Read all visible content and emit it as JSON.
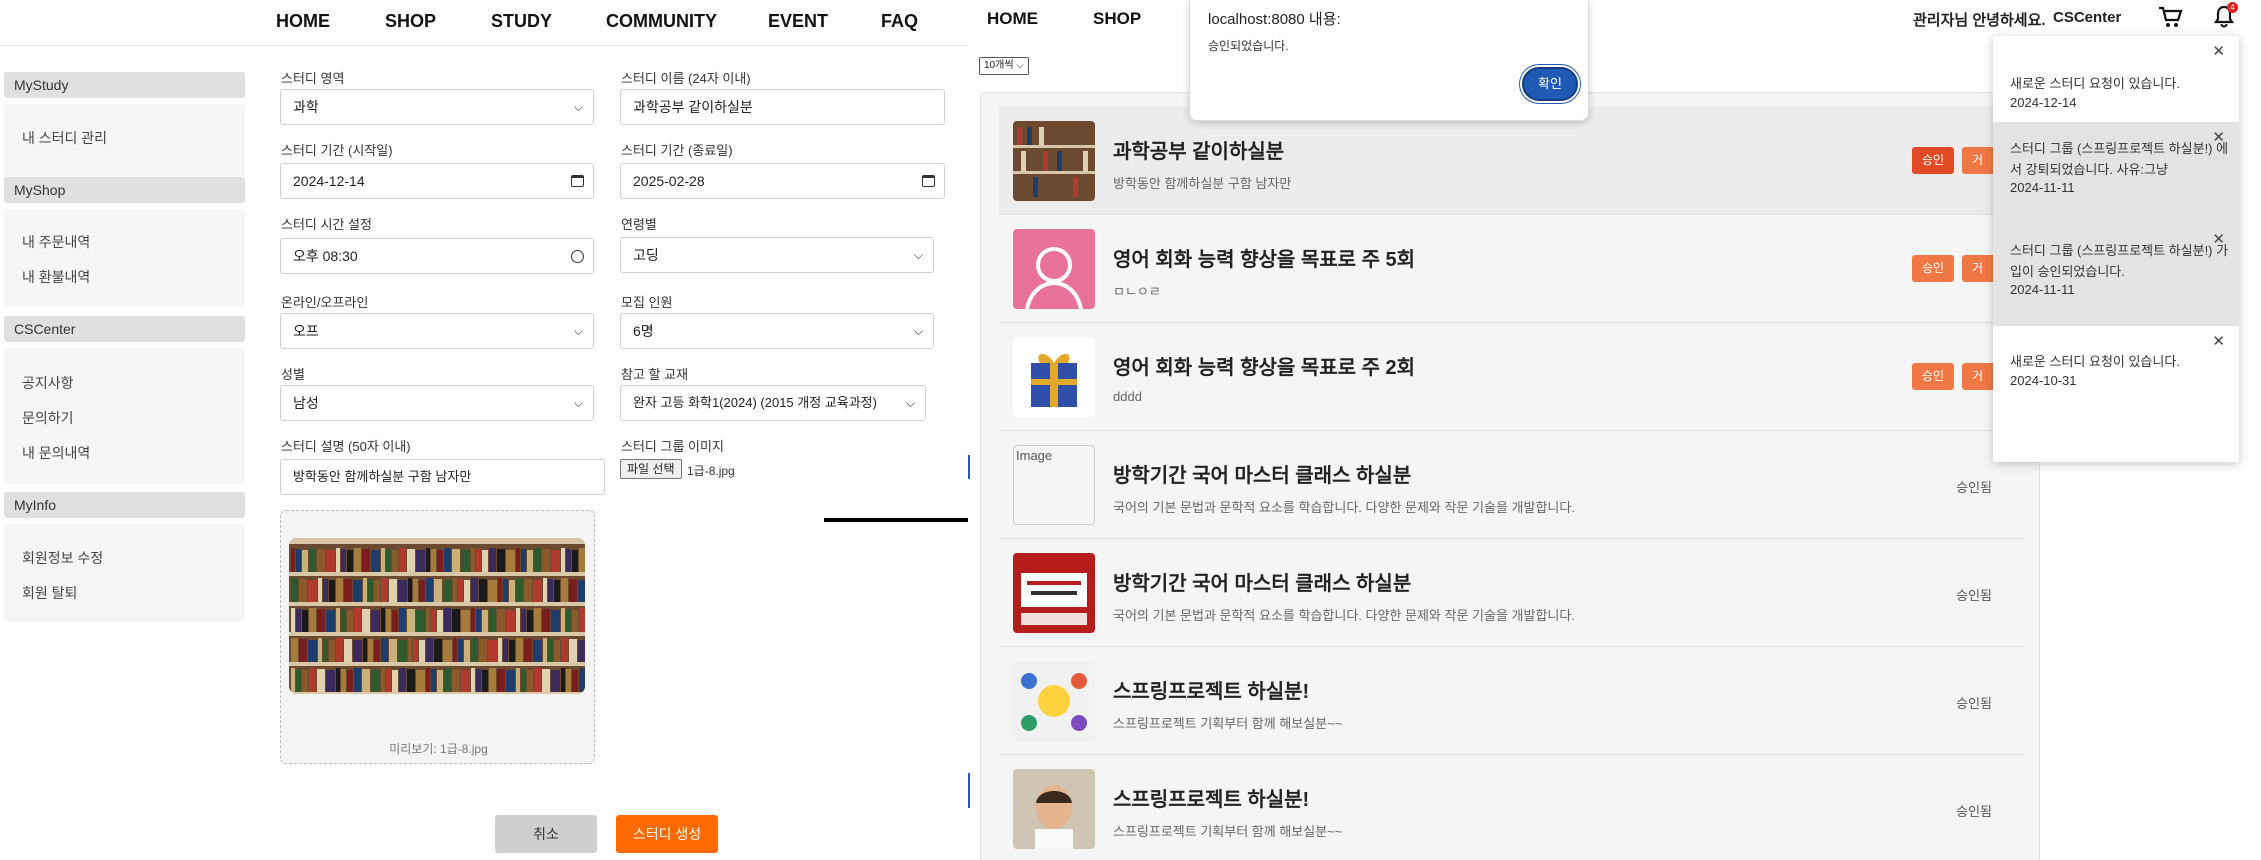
{
  "left_nav": [
    "HOME",
    "SHOP",
    "STUDY",
    "COMMUNITY",
    "EVENT",
    "FAQ"
  ],
  "sidebar": {
    "sections": [
      {
        "title": "MyStudy",
        "items": [
          "내 스터디 관리"
        ]
      },
      {
        "title": "MyShop",
        "items": [
          "내 주문내역",
          "내 환불내역"
        ]
      },
      {
        "title": "CSCenter",
        "items": [
          "공지사항",
          "문의하기",
          "내 문의내역"
        ]
      },
      {
        "title": "MyInfo",
        "items": [
          "회원정보 수정",
          "회원 탈퇴"
        ]
      }
    ]
  },
  "form": {
    "area_label": "스터디 영역",
    "area_value": "과학",
    "name_label": "스터디 이름 (24자 이내)",
    "name_value": "과학공부 같이하실분",
    "start_label": "스터디 기간 (시작일)",
    "start_value": "2024-12-14",
    "end_label": "스터디 기간 (종료일)",
    "end_value": "2025-02-28",
    "time_label": "스터디 시간 설정",
    "time_value": "오후  08:30",
    "age_label": "연령별",
    "age_value": "고딩",
    "mode_label": "온라인/오프라인",
    "mode_value": "오프",
    "capacity_label": "모집 인원",
    "capacity_value": "6명",
    "gender_label": "성별",
    "gender_value": "남성",
    "textbook_label": "참고 할 교재",
    "textbook_value": "완자 고등 화학1(2024) (2015 개정 교육과정)",
    "desc_label": "스터디 설명 (50자 이내)",
    "desc_value": "방학동안 함께하실분 구함 남자만",
    "image_label": "스터디 그룹 이미지",
    "file_button": "파일 선택",
    "file_name": "1급-8.jpg",
    "preview_caption": "미리보기: 1급-8.jpg",
    "cancel": "취소",
    "submit": "스터디 생성"
  },
  "right_nav": [
    "HOME",
    "SHOP"
  ],
  "header": {
    "greeting": "관리자님 안녕하세요.",
    "cscenter": "CSCenter",
    "badge": "4"
  },
  "page_size_select": "10개씩",
  "dialog": {
    "title": "localhost:8080 내용:",
    "message": "승인되었습니다.",
    "ok": "확인"
  },
  "studies": [
    {
      "title": "과학공부 같이하실분",
      "desc": "방학동안 함께하실분 구함 남자만",
      "approve": "승인",
      "reject": "거절",
      "thumb": "library"
    },
    {
      "title": "영어 회화 능력 향상을 목표로 주 5회",
      "desc": "ㅁㄴㅇㄹ",
      "approve": "승인",
      "reject": "거절",
      "thumb": "pink-avatar"
    },
    {
      "title": "영어 회화 능력 향상을 목표로 주 2회",
      "desc": "dddd",
      "approve": "승인",
      "reject": "거절",
      "thumb": "gift"
    },
    {
      "title": "방학기간 국어 마스터 클래스 하실분",
      "desc": "국어의 기본 문법과 문학적 요소를 학습합니다. 다양한 문제와 작문 기술을 개발합니다.",
      "status": "승인됨",
      "thumb_alt": "Image"
    },
    {
      "title": "방학기간 국어 마스터 클래스 하실분",
      "desc": "국어의 기본 문법과 문학적 요소를 학습합니다. 다양한 문제와 작문 기술을 개발합니다.",
      "status": "승인됨",
      "thumb": "poster"
    },
    {
      "title": "스프링프로젝트 하실분!",
      "desc": "스프링프로젝트 기획부터 함께 해보실분~~",
      "status": "승인됨",
      "thumb": "team"
    },
    {
      "title": "스프링프로젝트 하실분!",
      "desc": "스프링프로젝트 기획부터 함께 해보실분~~",
      "status": "승인됨",
      "thumb": "face"
    }
  ],
  "notifications": [
    {
      "text": "새로운 스터디 요청이 있습니다.",
      "date": "2024-12-14"
    },
    {
      "text": "스터디 그룹 (스프링프로젝트 하실분!) 에서 강퇴되었습니다. 사유:그냥",
      "date": "2024-11-11"
    },
    {
      "text": "스터디 그룹 (스프링프로젝트 하실분!) 가입이 승인되었습니다.",
      "date": "2024-11-11"
    },
    {
      "text": "새로운 스터디 요청이 있습니다.",
      "date": "2024-10-31"
    }
  ],
  "colors": {
    "accent_orange": "#ff6a00",
    "approve": "#f07844",
    "approve_active": "#e14a24",
    "dialog_button": "#1f5bb4"
  }
}
